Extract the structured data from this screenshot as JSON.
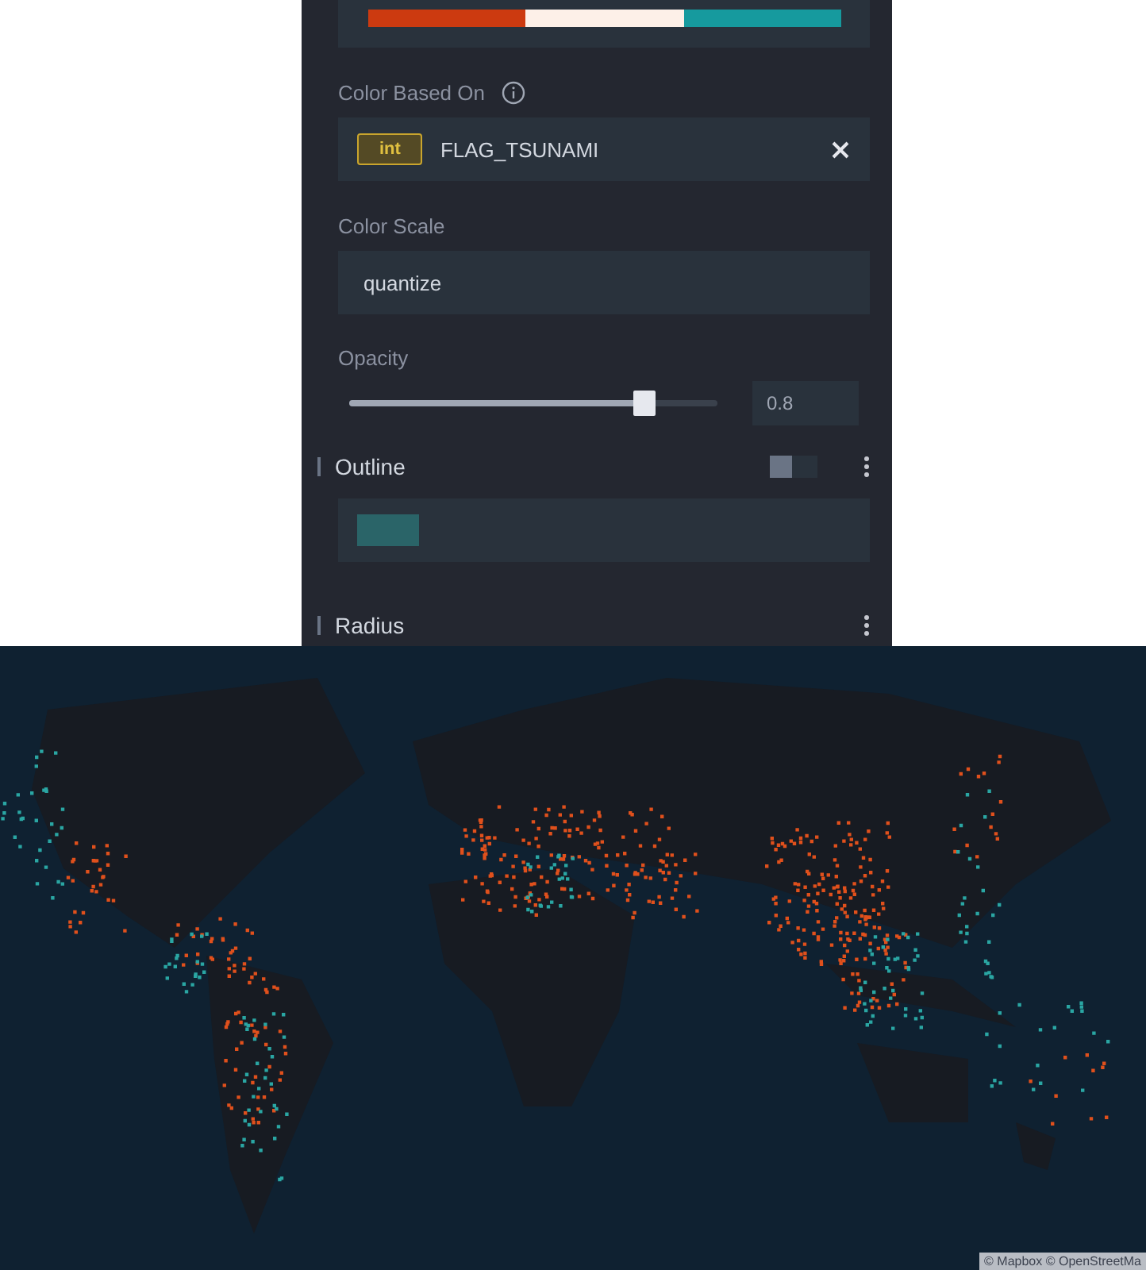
{
  "palette": [
    {
      "color": "#cc3a10"
    },
    {
      "color": "#fdf0e8"
    },
    {
      "color": "#169a9e"
    }
  ],
  "color_field": {
    "label": "Color Based On",
    "type_tag": "int",
    "value": "FLAG_TSUNAMI"
  },
  "color_scale": {
    "label": "Color Scale",
    "value": "quantize"
  },
  "opacity": {
    "label": "Opacity",
    "level": 0.8,
    "value": "0.8"
  },
  "outline": {
    "title": "Outline",
    "on": false,
    "color": "#2a6468"
  },
  "radius": {
    "title": "Radius"
  },
  "map": {
    "kind": "picture",
    "attribution": "© Mapbox © OpenStreetMa"
  }
}
